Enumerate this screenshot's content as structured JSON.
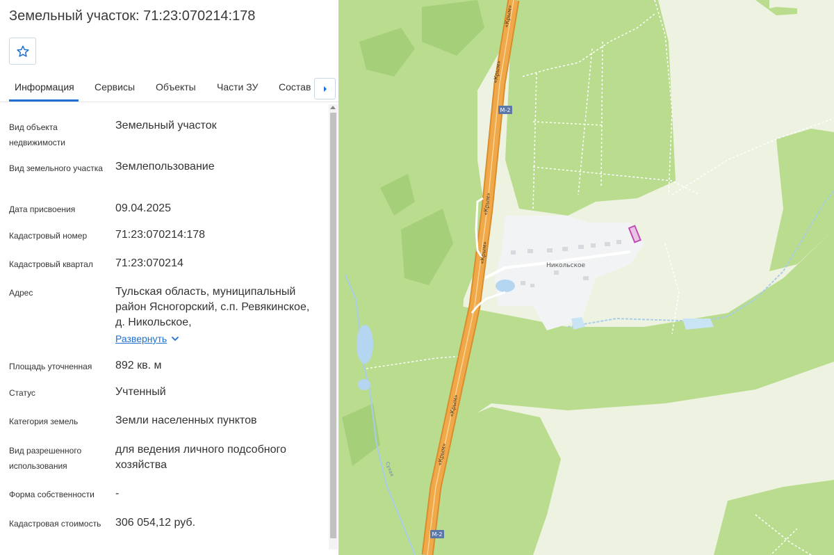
{
  "panel": {
    "title": "Земельный участок: 71:23:070214:178",
    "tabs": [
      "Информация",
      "Сервисы",
      "Объекты",
      "Части ЗУ",
      "Состав"
    ],
    "rows": {
      "object_type": {
        "label": "Вид объекта недвижимости",
        "value": "Земельный участок"
      },
      "land_type": {
        "label": "Вид земельного участка",
        "value": "Землепользование"
      },
      "date": {
        "label": "Дата присвоения",
        "value": "09.04.2025"
      },
      "cad_number": {
        "label": "Кадастровый номер",
        "value": "71:23:070214:178"
      },
      "cad_quarter": {
        "label": "Кадастровый квартал",
        "value": "71:23:070214"
      },
      "address": {
        "label": "Адрес",
        "value": "Тульская область, муниципальный район Ясногорский, с.п. Ревякинское, д. Никольское,"
      },
      "area": {
        "label": "Площадь уточненная",
        "value": "892 кв. м"
      },
      "status": {
        "label": "Статус",
        "value": "Учтенный"
      },
      "category": {
        "label": "Категория земель",
        "value": "Земли населенных пунктов"
      },
      "permitted_use": {
        "label": "Вид разрешенного использования",
        "value": "для ведения личного подсобного хозяйства"
      },
      "ownership": {
        "label": "Форма собственности",
        "value": "-"
      },
      "cad_value": {
        "label": "Кадастровая стоимость",
        "value": "306 054,12 руб."
      }
    },
    "expand_label": "Развернуть"
  },
  "map": {
    "village_label": "Никольское",
    "highway_name": "«Крым»",
    "route_badge": "М-2",
    "river_label": "Сухая",
    "colors": {
      "forest": "#b9dc8f",
      "field": "#eef3e1",
      "village": "#f1f3f4",
      "highway": "#f0a848",
      "water": "#b4d6f0",
      "parcel": "#c14bb5"
    }
  },
  "icons": {
    "favorite": "star-outline-icon",
    "tabs_next": "caret-right-icon",
    "expand": "chevron-down-icon"
  }
}
